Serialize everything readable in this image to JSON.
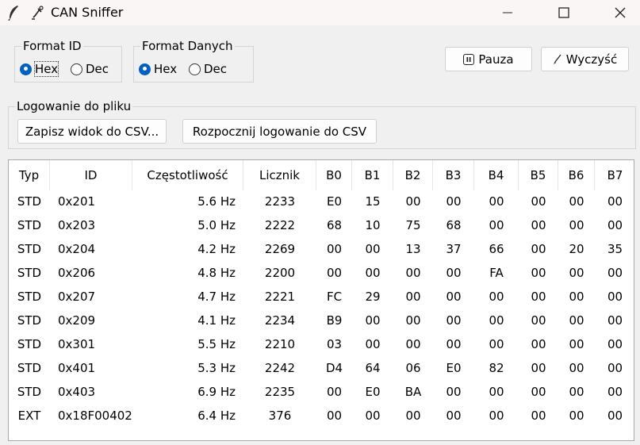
{
  "window": {
    "title": "CAN Sniffer"
  },
  "format_id": {
    "legend": "Format ID",
    "options": [
      "Hex",
      "Dec"
    ],
    "selected": "Hex"
  },
  "format_data": {
    "legend": "Format Danych",
    "options": [
      "Hex",
      "Dec"
    ],
    "selected": "Hex"
  },
  "toolbar": {
    "pause_label": "Pauza",
    "clear_label": "Wyczyść"
  },
  "logging": {
    "legend": "Logowanie do pliku",
    "save_view_label": "Zapisz widok do CSV...",
    "start_log_label": "Rozpocznij logowanie do CSV"
  },
  "table": {
    "columns": [
      "Typ",
      "ID",
      "Częstotliwość",
      "Licznik",
      "B0",
      "B1",
      "B2",
      "B3",
      "B4",
      "B5",
      "B6",
      "B7"
    ],
    "rows": [
      [
        "STD",
        "0x201",
        "5.6 Hz",
        "2233",
        "E0",
        "15",
        "00",
        "00",
        "00",
        "00",
        "00",
        "00"
      ],
      [
        "STD",
        "0x203",
        "5.0 Hz",
        "2222",
        "68",
        "10",
        "75",
        "68",
        "00",
        "00",
        "00",
        "00"
      ],
      [
        "STD",
        "0x204",
        "4.2 Hz",
        "2269",
        "00",
        "00",
        "13",
        "37",
        "66",
        "00",
        "20",
        "35"
      ],
      [
        "STD",
        "0x206",
        "4.8 Hz",
        "2200",
        "00",
        "00",
        "00",
        "00",
        "FA",
        "00",
        "00",
        "00"
      ],
      [
        "STD",
        "0x207",
        "4.7 Hz",
        "2221",
        "FC",
        "29",
        "00",
        "00",
        "00",
        "00",
        "00",
        "00"
      ],
      [
        "STD",
        "0x209",
        "4.1 Hz",
        "2234",
        "B9",
        "00",
        "00",
        "00",
        "00",
        "00",
        "00",
        "00"
      ],
      [
        "STD",
        "0x301",
        "5.5 Hz",
        "2210",
        "03",
        "00",
        "00",
        "00",
        "00",
        "00",
        "00",
        "00"
      ],
      [
        "STD",
        "0x401",
        "5.3 Hz",
        "2242",
        "D4",
        "64",
        "06",
        "E0",
        "82",
        "00",
        "00",
        "00"
      ],
      [
        "STD",
        "0x403",
        "6.9 Hz",
        "2235",
        "00",
        "E0",
        "BA",
        "00",
        "00",
        "00",
        "00",
        "00"
      ],
      [
        "EXT",
        "0x18F00402",
        "6.4 Hz",
        "376",
        "00",
        "00",
        "00",
        "00",
        "00",
        "00",
        "00",
        "00"
      ]
    ]
  }
}
